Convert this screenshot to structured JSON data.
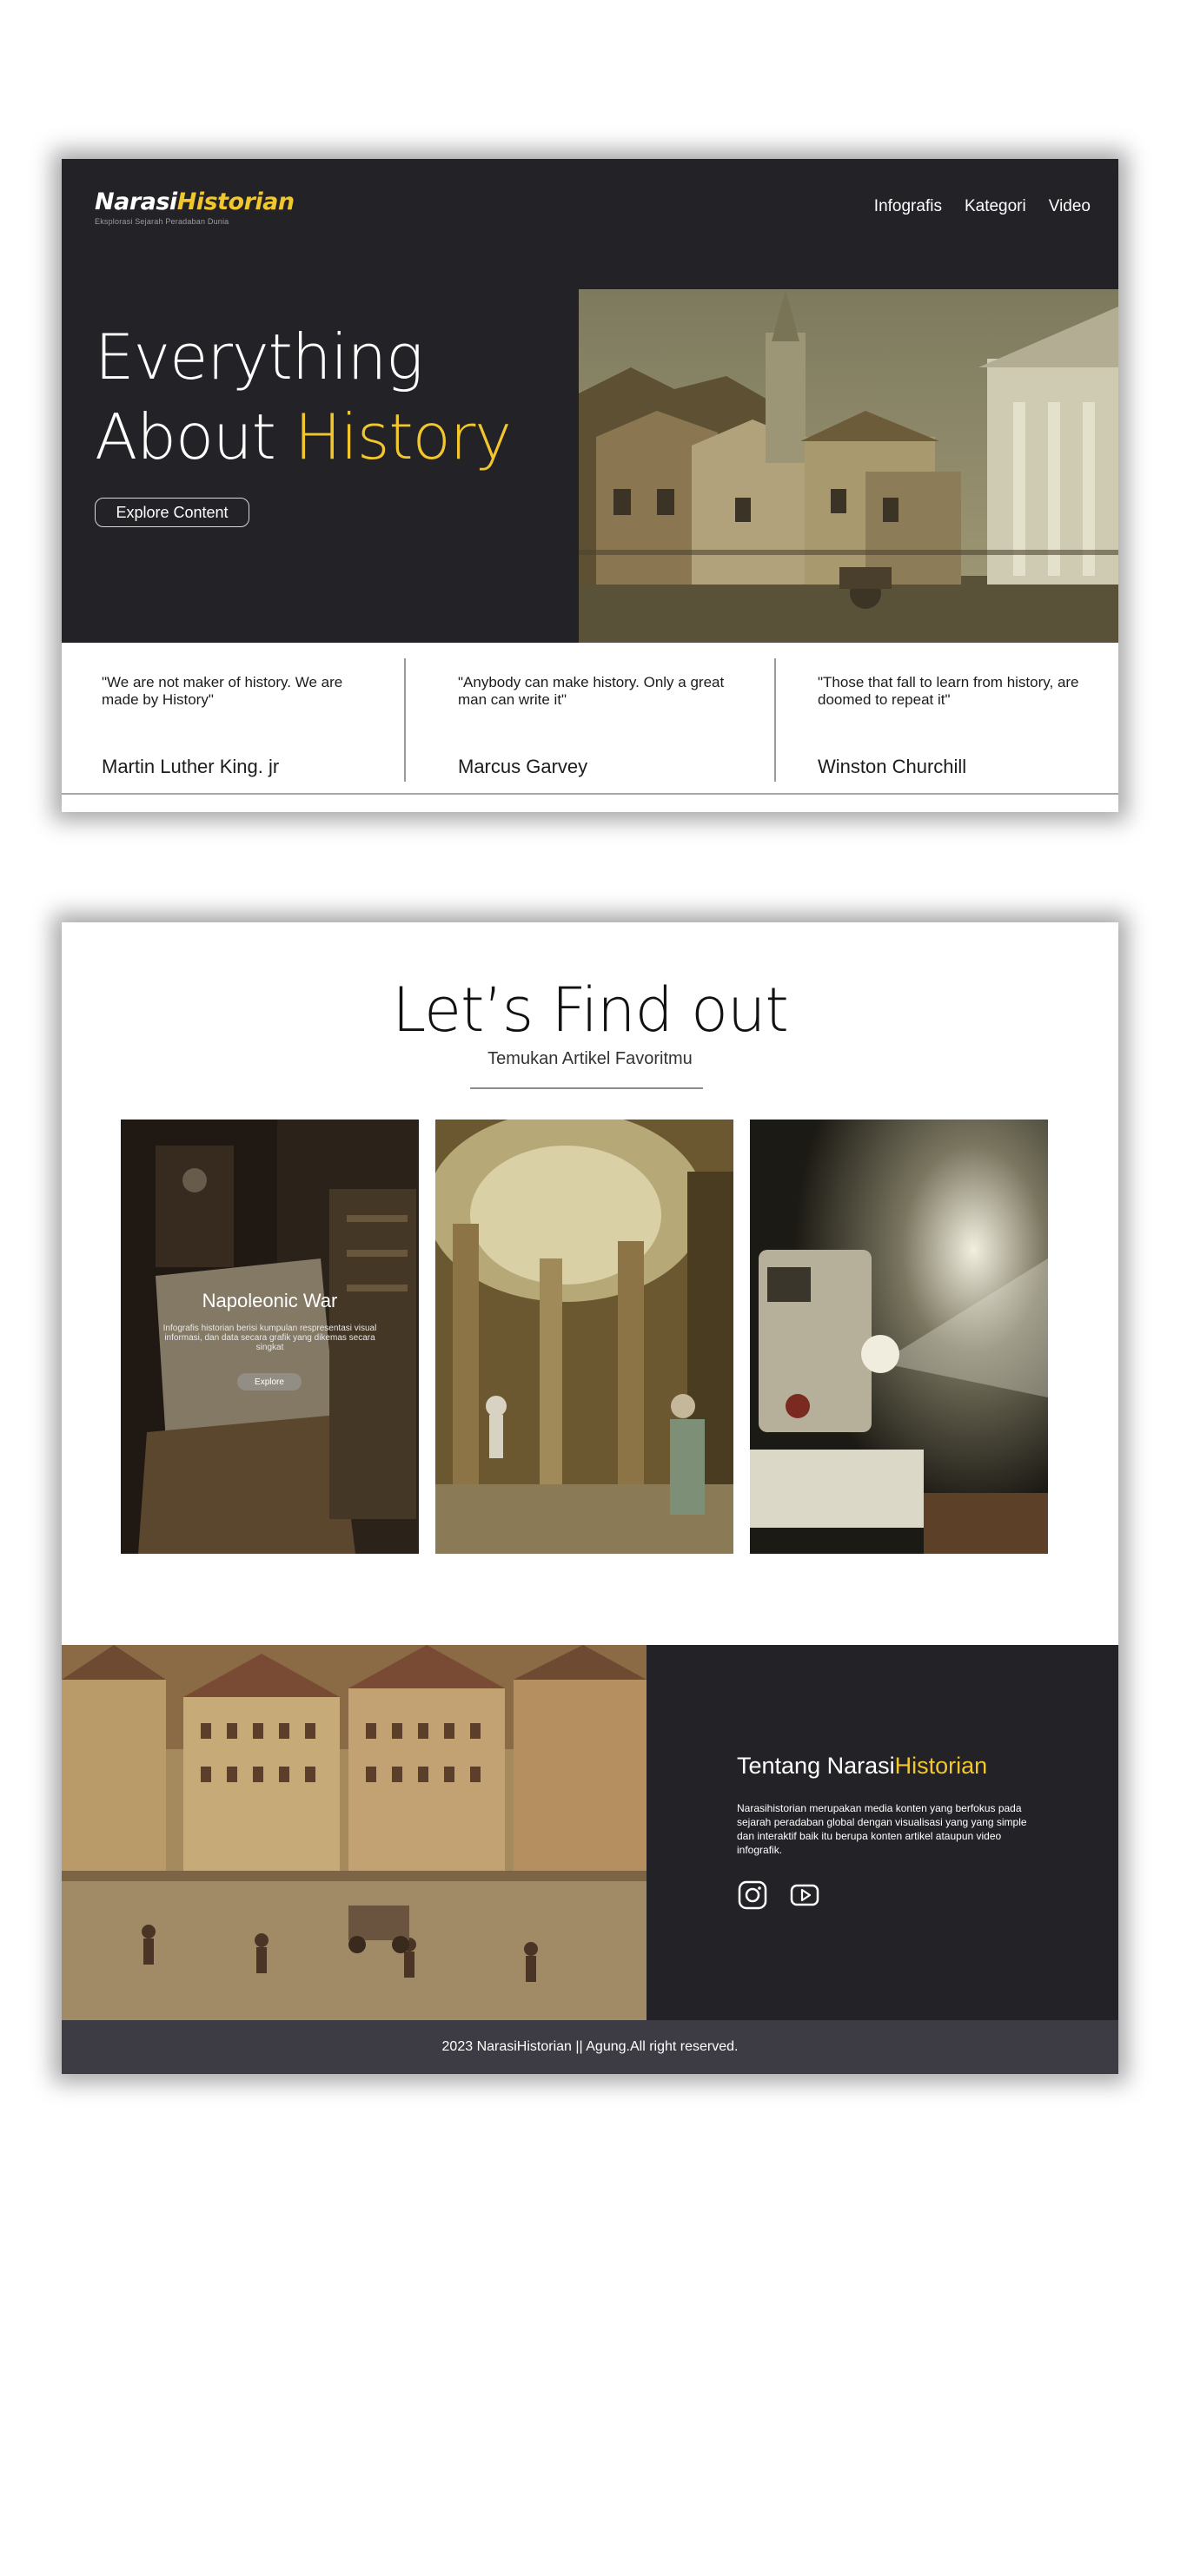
{
  "brand": {
    "logo_part1": "Narasi",
    "logo_part2": "Historian",
    "tagline": "Eksplorasi Sejarah Peradaban Dunia",
    "accent_color": "#f2c72d",
    "dark_bg": "#232226"
  },
  "nav": {
    "items": [
      {
        "label": "Infografis"
      },
      {
        "label": "Kategori"
      },
      {
        "label": "Video"
      }
    ]
  },
  "hero": {
    "title_line1": "Everything",
    "title_line2_plain": "About ",
    "title_line2_highlight": "History",
    "button_label": "Explore Content",
    "image_icon": "historic-town-street-painting"
  },
  "quotes": [
    {
      "text": "\"We are not maker of history. We are made by History\"",
      "author": "Martin Luther King. jr"
    },
    {
      "text": "\"Anybody can make history. Only a great man can write it\"",
      "author": "Marcus Garvey"
    },
    {
      "text": "\"Those that fall to learn from history, are doomed to repeat it\"",
      "author": "Winston Churchill"
    }
  ],
  "find": {
    "title": "Let’s Find out",
    "subtitle": "Temukan Artikel Favoritmu"
  },
  "tiles": [
    {
      "title": "Napoleonic War",
      "description": "Infografis historian berisi kumpulan respresentasi visual informasi, dan data secara grafik yang dikemas secara singkat",
      "button_label": "Explore",
      "image_icon": "old-documents-photo"
    },
    {
      "image_icon": "ancient-library-rotunda"
    },
    {
      "image_icon": "film-projector-photo"
    }
  ],
  "about": {
    "title_plain": "Tentang Narasi",
    "title_highlight": "Historian",
    "description": "Narasihistorian merupakan media konten yang berfokus pada sejarah peradaban global dengan visualisasi yang yang simple dan interaktif baik itu berupa konten artikel ataupun video infografik.",
    "image_icon": "medieval-town-square-painting",
    "social": [
      {
        "name": "instagram-icon"
      },
      {
        "name": "youtube-icon"
      }
    ]
  },
  "footer": {
    "text": "2023 NarasiHistorian || Agung.All right reserved."
  }
}
